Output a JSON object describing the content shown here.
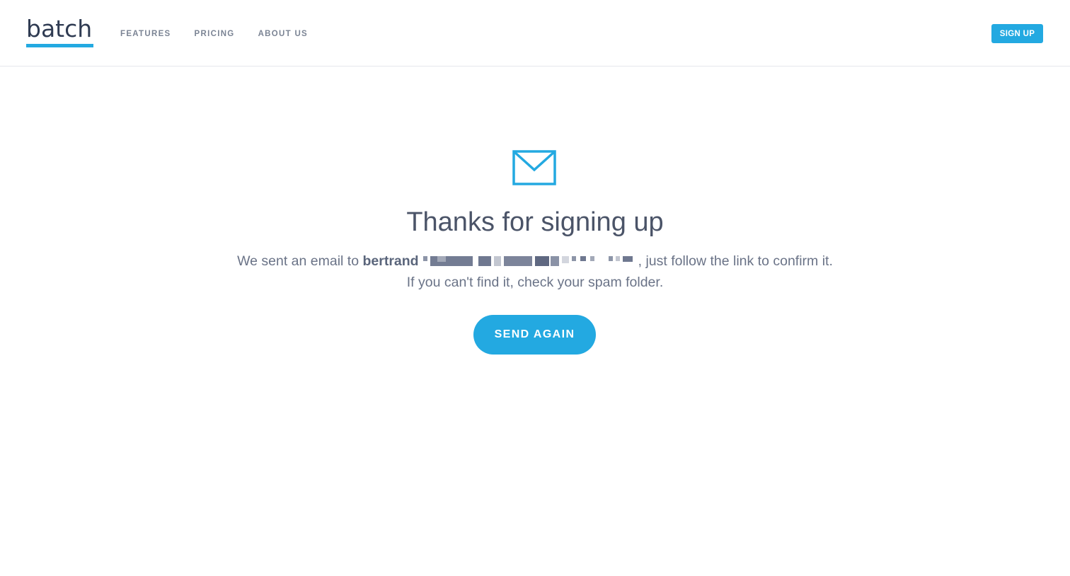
{
  "header": {
    "logo_text": "batch",
    "nav": [
      {
        "label": "FEATURES"
      },
      {
        "label": "PRICING"
      },
      {
        "label": "ABOUT US"
      }
    ],
    "signup_label": "SIGN UP"
  },
  "main": {
    "icon": "mail-icon",
    "title": "Thanks for signing up",
    "message": {
      "prefix": "We sent an email to ",
      "email_visible": "bertrand",
      "suffix": ", just follow the link to confirm it.",
      "line2": "If you can't find it, check your spam folder."
    },
    "send_again_label": "SEND AGAIN"
  },
  "colors": {
    "accent": "#23a9e1",
    "heading": "#4b5468",
    "body_text": "#6a7387",
    "nav_text": "#7b8494",
    "logo_text": "#2f3b52"
  }
}
